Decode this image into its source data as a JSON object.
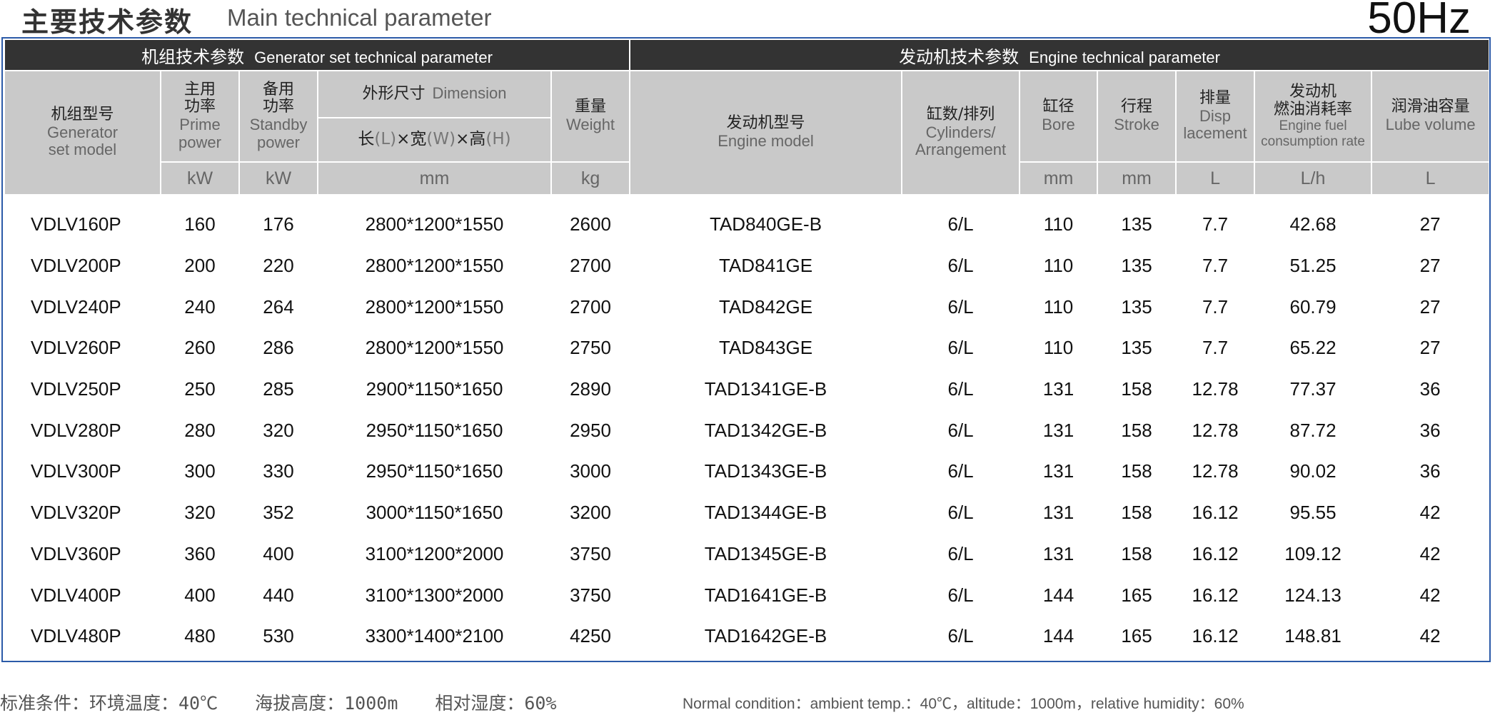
{
  "header": {
    "title_zh": "主要技术参数",
    "title_en": "Main technical parameter",
    "frequency": "50Hz"
  },
  "sections": {
    "generator": {
      "zh": "机组技术参数",
      "en": "Generator set technical parameter"
    },
    "engine": {
      "zh": "发动机技术参数",
      "en": "Engine technical parameter"
    }
  },
  "columns": {
    "model": {
      "zh": "机组型号",
      "en1": "Generator",
      "en2": "set model"
    },
    "prime": {
      "zh1": "主用",
      "zh2": "功率",
      "en1": "Prime",
      "en2": "power",
      "unit": "kW"
    },
    "standby": {
      "zh1": "备用",
      "zh2": "功率",
      "en1": "Standby",
      "en2": "power",
      "unit": "kW"
    },
    "dimension": {
      "zh": "外形尺寸",
      "en": "Dimension",
      "formula": {
        "l_zh": "长",
        "l": "(L)",
        "x1": "×",
        "w_zh": "宽",
        "w": "(W)",
        "x2": "×",
        "h_zh": "高",
        "h": "(H)"
      },
      "unit": "mm"
    },
    "weight": {
      "zh": "重量",
      "en": "Weight",
      "unit": "kg"
    },
    "engine_model": {
      "zh": "发动机型号",
      "en": "Engine model"
    },
    "cylinders": {
      "zh": "缸数/排列",
      "en1": "Cylinders/",
      "en2": "Arrangement"
    },
    "bore": {
      "zh": "缸径",
      "en": "Bore",
      "unit": "mm"
    },
    "stroke": {
      "zh": "行程",
      "en": "Stroke",
      "unit": "mm"
    },
    "displacement": {
      "zh": "排量",
      "en1": "Disp",
      "en2": "lacement",
      "unit": "L"
    },
    "fuel": {
      "zh1": "发动机",
      "zh2": "燃油消耗率",
      "en1": "Engine fuel",
      "en2": "consumption rate",
      "unit": "L/h"
    },
    "lube": {
      "zh": "润滑油容量",
      "en": "Lube volume",
      "unit": "L"
    }
  },
  "rows": [
    [
      "VDLV160P",
      "160",
      "176",
      "2800*1200*1550",
      "2600",
      "TAD840GE-B",
      "6/L",
      "110",
      "135",
      "7.7",
      "42.68",
      "27"
    ],
    [
      "VDLV200P",
      "200",
      "220",
      "2800*1200*1550",
      "2700",
      "TAD841GE",
      "6/L",
      "110",
      "135",
      "7.7",
      "51.25",
      "27"
    ],
    [
      "VDLV240P",
      "240",
      "264",
      "2800*1200*1550",
      "2700",
      "TAD842GE",
      "6/L",
      "110",
      "135",
      "7.7",
      "60.79",
      "27"
    ],
    [
      "VDLV260P",
      "260",
      "286",
      "2800*1200*1550",
      "2750",
      "TAD843GE",
      "6/L",
      "110",
      "135",
      "7.7",
      "65.22",
      "27"
    ],
    [
      "VDLV250P",
      "250",
      "285",
      "2900*1150*1650",
      "2890",
      "TAD1341GE-B",
      "6/L",
      "131",
      "158",
      "12.78",
      "77.37",
      "36"
    ],
    [
      "VDLV280P",
      "280",
      "320",
      "2950*1150*1650",
      "2950",
      "TAD1342GE-B",
      "6/L",
      "131",
      "158",
      "12.78",
      "87.72",
      "36"
    ],
    [
      "VDLV300P",
      "300",
      "330",
      "2950*1150*1650",
      "3000",
      "TAD1343GE-B",
      "6/L",
      "131",
      "158",
      "12.78",
      "90.02",
      "36"
    ],
    [
      "VDLV320P",
      "320",
      "352",
      "3000*1150*1650",
      "3200",
      "TAD1344GE-B",
      "6/L",
      "131",
      "158",
      "16.12",
      "95.55",
      "42"
    ],
    [
      "VDLV360P",
      "360",
      "400",
      "3100*1200*2000",
      "3750",
      "TAD1345GE-B",
      "6/L",
      "131",
      "158",
      "16.12",
      "109.12",
      "42"
    ],
    [
      "VDLV400P",
      "400",
      "440",
      "3100*1300*2000",
      "3750",
      "TAD1641GE-B",
      "6/L",
      "144",
      "165",
      "16.12",
      "124.13",
      "42"
    ],
    [
      "VDLV480P",
      "480",
      "530",
      "3300*1400*2100",
      "4250",
      "TAD1642GE-B",
      "6/L",
      "144",
      "165",
      "16.12",
      "148.81",
      "42"
    ]
  ],
  "footer": {
    "zh_condition": "标准条件：环境温度：40℃",
    "zh_altitude": "海拔高度：1000m",
    "zh_humidity": "相对湿度：60%",
    "en": "Normal condition：ambient temp.：40℃，altitude：1000m，relative humidity：60%"
  }
}
